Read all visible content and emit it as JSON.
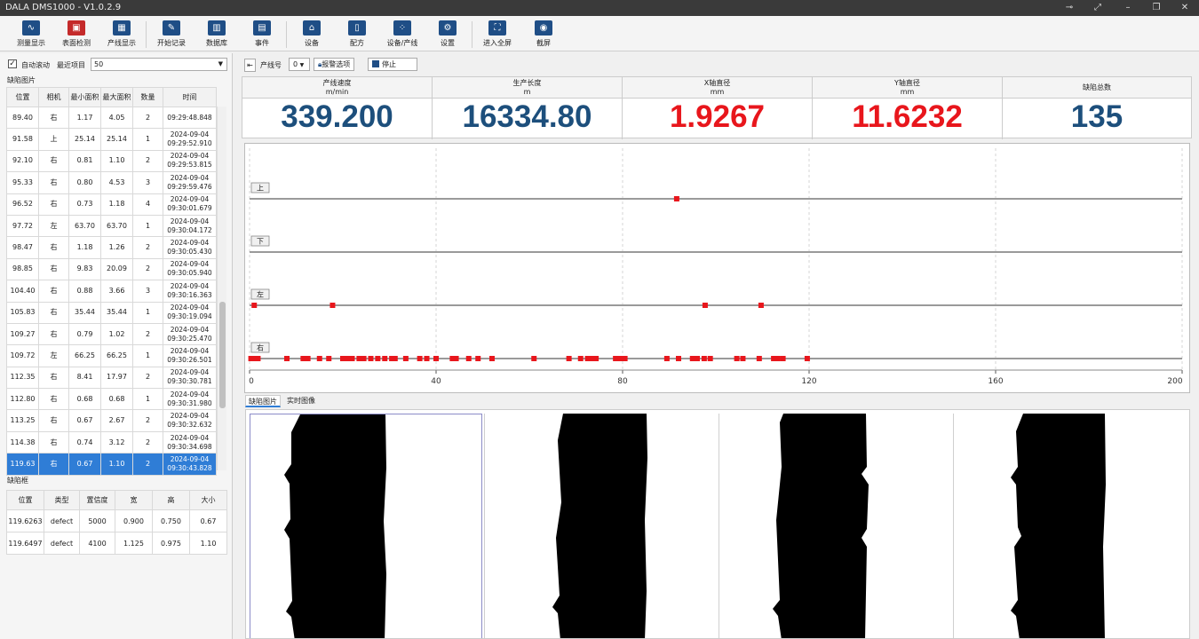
{
  "window": {
    "title": "DALA DMS1000 - V1.0.2.9"
  },
  "toolbar": {
    "items": [
      {
        "label": "测量显示",
        "icon": "wave-icon"
      },
      {
        "label": "表面检测",
        "icon": "surface-icon"
      },
      {
        "label": "产线显示",
        "icon": "grid-icon"
      },
      {
        "label": "开始记录",
        "icon": "pen-icon"
      },
      {
        "label": "数据库",
        "icon": "barchart-icon"
      },
      {
        "label": "事件",
        "icon": "monitor-icon"
      },
      {
        "label": "设备",
        "icon": "device-icon"
      },
      {
        "label": "配方",
        "icon": "document-icon"
      },
      {
        "label": "设备/产线",
        "icon": "grid-icon"
      },
      {
        "label": "设置",
        "icon": "gear-icon"
      },
      {
        "label": "进入全屏",
        "icon": "fullscreen-icon"
      },
      {
        "label": "截屏",
        "icon": "camera-icon"
      }
    ]
  },
  "left": {
    "auto_scroll": "自动滚动",
    "recent_label": "最近项目",
    "recent_value": "50",
    "defect_images_title": "缺陷图片",
    "defect_columns": [
      "位置",
      "相机",
      "最小面积",
      "最大面积",
      "数量",
      "时间"
    ],
    "defect_rows": [
      [
        "89.40",
        "右",
        "1.17",
        "4.05",
        "2",
        "09:29:48.848"
      ],
      [
        "91.58",
        "上",
        "25.14",
        "25.14",
        "1",
        "2024-09-04 09:29:52.910"
      ],
      [
        "92.10",
        "右",
        "0.81",
        "1.10",
        "2",
        "2024-09-04 09:29:53.815"
      ],
      [
        "95.33",
        "右",
        "0.80",
        "4.53",
        "3",
        "2024-09-04 09:29:59.476"
      ],
      [
        "96.52",
        "右",
        "0.73",
        "1.18",
        "4",
        "2024-09-04 09:30:01.679"
      ],
      [
        "97.72",
        "左",
        "63.70",
        "63.70",
        "1",
        "2024-09-04 09:30:04.172"
      ],
      [
        "98.47",
        "右",
        "1.18",
        "1.26",
        "2",
        "2024-09-04 09:30:05.430"
      ],
      [
        "98.85",
        "右",
        "9.83",
        "20.09",
        "2",
        "2024-09-04 09:30:05.940"
      ],
      [
        "104.40",
        "右",
        "0.88",
        "3.66",
        "3",
        "2024-09-04 09:30:16.363"
      ],
      [
        "105.83",
        "右",
        "35.44",
        "35.44",
        "1",
        "2024-09-04 09:30:19.094"
      ],
      [
        "109.27",
        "右",
        "0.79",
        "1.02",
        "2",
        "2024-09-04 09:30:25.470"
      ],
      [
        "109.72",
        "左",
        "66.25",
        "66.25",
        "1",
        "2024-09-04 09:30:26.501"
      ],
      [
        "112.35",
        "右",
        "8.41",
        "17.97",
        "2",
        "2024-09-04 09:30:30.781"
      ],
      [
        "112.80",
        "右",
        "0.68",
        "0.68",
        "1",
        "2024-09-04 09:30:31.980"
      ],
      [
        "113.25",
        "右",
        "0.67",
        "2.67",
        "2",
        "2024-09-04 09:30:32.632"
      ],
      [
        "114.38",
        "右",
        "0.74",
        "3.12",
        "2",
        "2024-09-04 09:30:34.698"
      ],
      [
        "119.63",
        "右",
        "0.67",
        "1.10",
        "2",
        "2024-09-04 09:30:43.828"
      ]
    ],
    "selected_row": 16,
    "defect_frame_title": "缺陷框",
    "frame_columns": [
      "位置",
      "类型",
      "置信度",
      "宽",
      "高",
      "大小"
    ],
    "frame_rows": [
      [
        "119.6263",
        "defect",
        "5000",
        "0.900",
        "0.750",
        "0.67"
      ],
      [
        "119.6497",
        "defect",
        "4100",
        "1.125",
        "0.975",
        "1.10"
      ]
    ]
  },
  "right": {
    "line_label": "产线号",
    "line_value": "0",
    "alarm_button": "报警选项",
    "stop_button": "停止",
    "metrics": [
      {
        "title": "产线速度",
        "unit": "m/min",
        "value": "339.200",
        "color": "#1d4f7c"
      },
      {
        "title": "生产长度",
        "unit": "m",
        "value": "16334.80",
        "color": "#1d4f7c"
      },
      {
        "title": "X轴直径",
        "unit": "mm",
        "value": "1.9267",
        "color": "#e8161c"
      },
      {
        "title": "Y轴直径",
        "unit": "mm",
        "value": "11.6232",
        "color": "#e8161c"
      },
      {
        "title": "缺陷总数",
        "unit": "",
        "value": "135",
        "color": "#1d4f7c"
      }
    ],
    "image_tabs": [
      "缺陷图片",
      "实时图像"
    ]
  },
  "chart_data": {
    "type": "scatter",
    "xlim": [
      0,
      200
    ],
    "x_ticks": [
      0,
      40,
      80,
      120,
      160,
      200
    ],
    "lanes": [
      "上",
      "下",
      "左",
      "右"
    ],
    "marker_color": "#e8161c",
    "series": [
      {
        "name": "上",
        "x": [
          91.6
        ]
      },
      {
        "name": "下",
        "x": []
      },
      {
        "name": "左",
        "x": [
          1,
          17.8,
          97.7,
          109.7
        ]
      },
      {
        "name": "右",
        "x": [
          0.3,
          0.8,
          1.3,
          1.8,
          8,
          11.5,
          12.5,
          15,
          17,
          20,
          21,
          22,
          23.5,
          24.5,
          26,
          27.5,
          29,
          30.5,
          31.2,
          33.5,
          36.5,
          38,
          40,
          43.5,
          44.3,
          47,
          49,
          52,
          61,
          68.5,
          71,
          72.5,
          73.5,
          74.3,
          78.5,
          79.5,
          80.5,
          89.5,
          92,
          95,
          96,
          97.5,
          98.8,
          104.5,
          105.8,
          109.3,
          112.4,
          112.9,
          113.3,
          114.4,
          119.6
        ]
      }
    ]
  }
}
